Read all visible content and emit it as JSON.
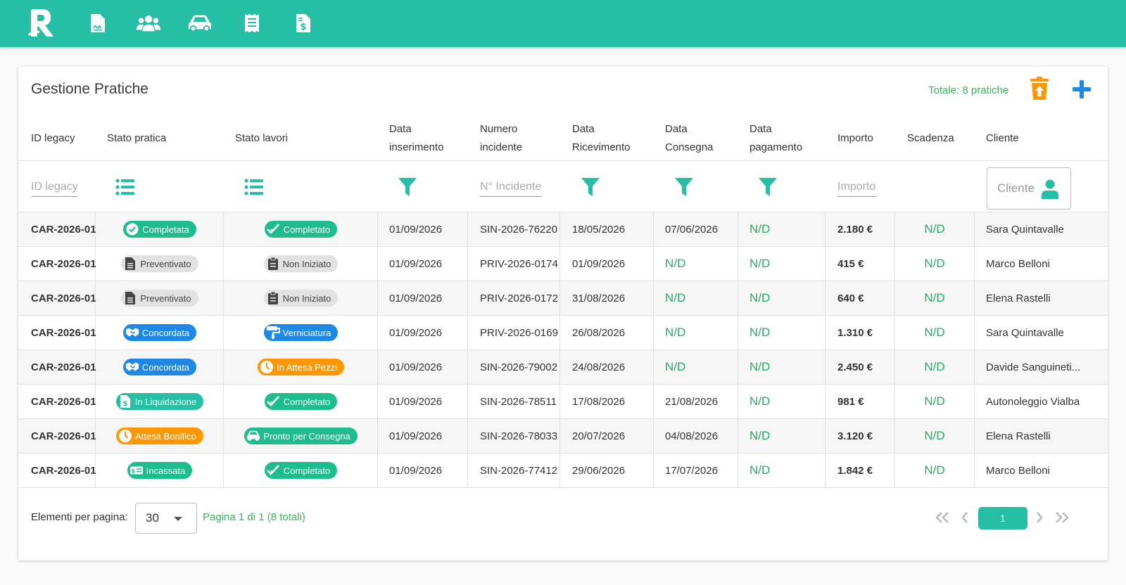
{
  "colors": {
    "primary": "#26bfa6",
    "green": "#1ebd8e",
    "grey": "#e2e2e2",
    "blue": "#1e88e5",
    "orange": "#ff9800",
    "teal": "#26bfa6",
    "nd": "#2aaa66"
  },
  "nav": {
    "logo": "logo-r",
    "icons": [
      "document-signature-icon",
      "users-icon",
      "car-icon",
      "receipt-icon",
      "invoice-dollar-icon"
    ]
  },
  "page": {
    "title": "Gestione Pratiche",
    "total": "Totale: 8 pratiche"
  },
  "table": {
    "headers": {
      "id_legacy": "ID legacy",
      "stato_pratica": "Stato pratica",
      "stato_lavori": "Stato lavori",
      "data_inserimento_1": "Data",
      "data_inserimento_2": "inserimento",
      "numero_incidente_1": "Numero",
      "numero_incidente_2": "incidente",
      "data_ricevimento_1": "Data",
      "data_ricevimento_2": "Ricevimento",
      "data_consegna_1": "Data",
      "data_consegna_2": "Consegna",
      "data_pagamento_1": "Data",
      "data_pagamento_2": "pagamento",
      "importo": "Importo",
      "scadenza": "Scadenza",
      "cliente": "Cliente"
    },
    "filters": {
      "id_legacy_placeholder": "ID legacy",
      "numero_incidente_placeholder": "N° Incidente",
      "importo_placeholder": "Importo",
      "cliente_placeholder": "Cliente"
    },
    "rows": [
      {
        "id": "CAR-2026-01",
        "stato_pratica": {
          "label": "Completata",
          "color": "green",
          "icon": "check-circle-icon"
        },
        "stato_lavori": {
          "label": "Completato",
          "color": "green",
          "icon": "double-check-icon"
        },
        "data_inserimento": "01/09/2026",
        "numero_incidente": "SIN-2026-76220",
        "data_ricevimento": "18/05/2026",
        "data_consegna": "07/06/2026",
        "data_pagamento": "N/D",
        "importo": "2.180 €",
        "scadenza": "N/D",
        "cliente": "Sara Quintavalle"
      },
      {
        "id": "CAR-2026-01",
        "stato_pratica": {
          "label": "Preventivato",
          "color": "grey",
          "icon": "document-icon"
        },
        "stato_lavori": {
          "label": "Non Iniziato",
          "color": "grey",
          "icon": "clipboard-icon"
        },
        "data_inserimento": "01/09/2026",
        "numero_incidente": "PRIV-2026-0174",
        "data_ricevimento": "01/09/2026",
        "data_consegna": "N/D",
        "data_pagamento": "N/D",
        "importo": "415 €",
        "scadenza": "N/D",
        "cliente": "Marco Belloni"
      },
      {
        "id": "CAR-2026-01",
        "stato_pratica": {
          "label": "Preventivato",
          "color": "grey",
          "icon": "document-icon"
        },
        "stato_lavori": {
          "label": "Non Iniziato",
          "color": "grey",
          "icon": "clipboard-icon"
        },
        "data_inserimento": "01/09/2026",
        "numero_incidente": "PRIV-2026-0172",
        "data_ricevimento": "31/08/2026",
        "data_consegna": "N/D",
        "data_pagamento": "N/D",
        "importo": "640 €",
        "scadenza": "N/D",
        "cliente": "Elena Rastelli"
      },
      {
        "id": "CAR-2026-01",
        "stato_pratica": {
          "label": "Concordata",
          "color": "blue",
          "icon": "handshake-icon"
        },
        "stato_lavori": {
          "label": "Verniciatura",
          "color": "blue",
          "icon": "paint-roller-icon"
        },
        "data_inserimento": "01/09/2026",
        "numero_incidente": "PRIV-2026-0169",
        "data_ricevimento": "26/08/2026",
        "data_consegna": "N/D",
        "data_pagamento": "N/D",
        "importo": "1.310 €",
        "scadenza": "N/D",
        "cliente": "Sara Quintavalle"
      },
      {
        "id": "CAR-2026-01",
        "stato_pratica": {
          "label": "Concordata",
          "color": "blue",
          "icon": "handshake-icon"
        },
        "stato_lavori": {
          "label": "In Attesa Pezzi",
          "color": "orange",
          "icon": "clock-icon"
        },
        "data_inserimento": "01/09/2026",
        "numero_incidente": "SIN-2026-79002",
        "data_ricevimento": "24/08/2026",
        "data_consegna": "N/D",
        "data_pagamento": "N/D",
        "importo": "2.450 €",
        "scadenza": "N/D",
        "cliente": "Davide Sanguineti..."
      },
      {
        "id": "CAR-2026-01",
        "stato_pratica": {
          "label": "In Liquidazione",
          "color": "teal",
          "icon": "file-dollar-icon"
        },
        "stato_lavori": {
          "label": "Completato",
          "color": "green",
          "icon": "double-check-icon"
        },
        "data_inserimento": "01/09/2026",
        "numero_incidente": "SIN-2026-78511",
        "data_ricevimento": "17/08/2026",
        "data_consegna": "21/08/2026",
        "data_pagamento": "N/D",
        "importo": "981 €",
        "scadenza": "N/D",
        "cliente": "Autonoleggio Vialba"
      },
      {
        "id": "CAR-2026-01",
        "stato_pratica": {
          "label": "Attesa Bonifico",
          "color": "orange",
          "icon": "clock-icon"
        },
        "stato_lavori": {
          "label": "Pronto per Consegna",
          "color": "green",
          "icon": "car-icon"
        },
        "data_inserimento": "01/09/2026",
        "numero_incidente": "SIN-2026-78033",
        "data_ricevimento": "20/07/2026",
        "data_consegna": "04/08/2026",
        "data_pagamento": "N/D",
        "importo": "3.120 €",
        "scadenza": "N/D",
        "cliente": "Elena Rastelli"
      },
      {
        "id": "CAR-2026-01",
        "stato_pratica": {
          "label": "Incassata",
          "color": "green",
          "icon": "money-bill-icon"
        },
        "stato_lavori": {
          "label": "Completato",
          "color": "green",
          "icon": "double-check-icon"
        },
        "data_inserimento": "01/09/2026",
        "numero_incidente": "SIN-2026-77412",
        "data_ricevimento": "29/06/2026",
        "data_consegna": "17/07/2026",
        "data_pagamento": "N/D",
        "importo": "1.842 €",
        "scadenza": "N/D",
        "cliente": "Marco Belloni"
      }
    ]
  },
  "pagination": {
    "per_page_label": "Elementi per pagina:",
    "per_page_value": "30",
    "info": "Pagina 1 di 1 (8 totali)",
    "current_page": "1"
  }
}
